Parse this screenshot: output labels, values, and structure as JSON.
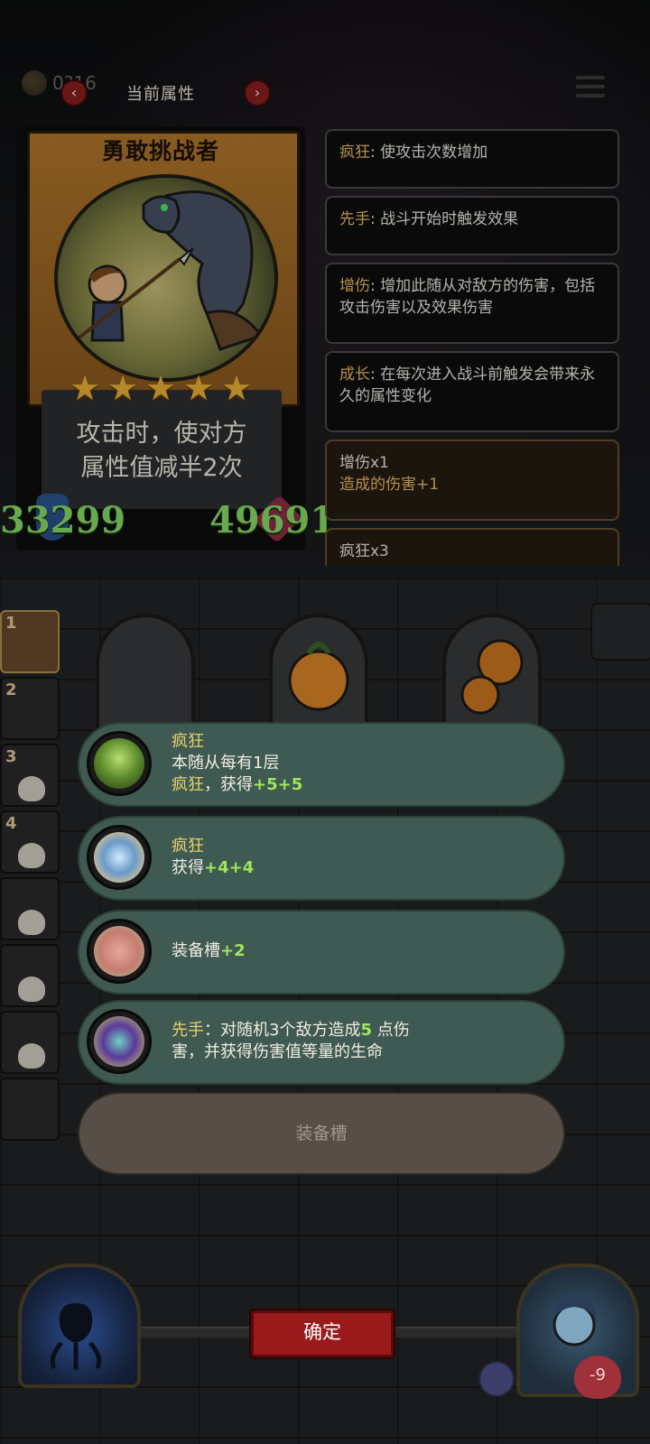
{
  "header": {
    "coins": "0?16",
    "title": "当前属性",
    "prev_label": "‹",
    "next_label": "›"
  },
  "hero_card": {
    "name": "勇敢挑战者",
    "stars": 5,
    "ability_line1": "攻击时，使对方",
    "ability_line2": "属性值减半2次",
    "attack": "33299",
    "health": "49691"
  },
  "keywords": [
    {
      "name": "疯狂",
      "sep": ": ",
      "desc": "使攻击次数增加"
    },
    {
      "name": "先手",
      "sep": ": ",
      "desc": "战斗开始时触发效果"
    },
    {
      "name": "增伤",
      "sep": ": ",
      "desc": "增加此随从对敌方的伤害，包括攻击伤害以及效果伤害"
    },
    {
      "name": "成长",
      "sep": ": ",
      "desc": "在每次进入战斗前触发会带来永久的属性变化"
    }
  ],
  "current_effects": [
    {
      "title": "增伤x1",
      "detail": "造成的伤害+1"
    },
    {
      "title": "疯狂x3",
      "detail": ""
    }
  ],
  "lineup": {
    "slot_numbers": [
      "1",
      "2",
      "3",
      "4"
    ]
  },
  "equipment_list": [
    {
      "icon": "green-skull-icon",
      "line1_keyword": "疯狂",
      "line2": "本随从每有1层",
      "line3_keyword": "疯狂",
      "line3_rest": "，获得",
      "line3_value": "+5+5"
    },
    {
      "icon": "crystal-icon",
      "line1_keyword": "疯狂",
      "line2_prefix": "获得",
      "line2_value": "+4+4"
    },
    {
      "icon": "pig-icon",
      "text_prefix": "装备槽",
      "text_value": "+2"
    },
    {
      "icon": "purple-blade-icon",
      "keyword": "先手",
      "text_a": "：对随机3个敌方造成",
      "value": "5",
      "text_b": " 点伤",
      "line2": "害，并获得伤害值等量的生命"
    }
  ],
  "equipment_slot_label": "装备槽",
  "confirm_label": "确定",
  "enemy_hp": "-9",
  "colors": {
    "keyword": "#f1c06a",
    "stat_green": "#8be26a",
    "confirm_red": "#9a1a1c",
    "entry_teal": "#3f5a52"
  }
}
